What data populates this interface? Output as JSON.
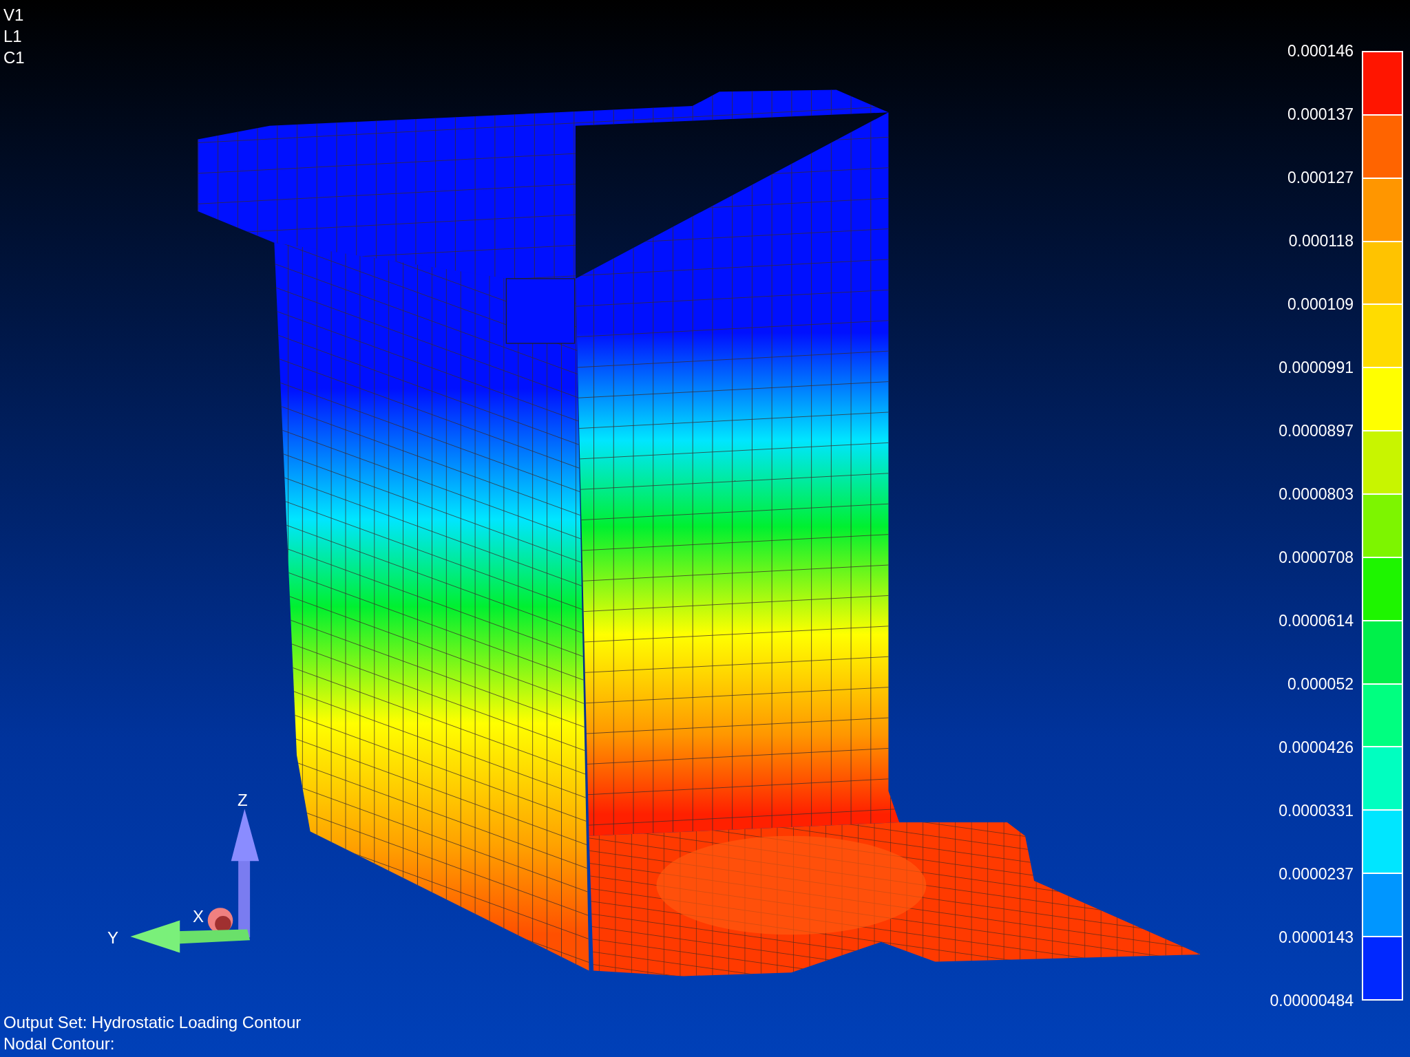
{
  "view_labels": [
    "V1",
    "L1",
    "C1"
  ],
  "legend": {
    "labels": [
      "0.000146",
      "0.000137",
      "0.000127",
      "0.000118",
      "0.000109",
      "0.0000991",
      "0.0000897",
      "0.0000803",
      "0.0000708",
      "0.0000614",
      "0.000052",
      "0.0000426",
      "0.0000331",
      "0.0000237",
      "0.0000143",
      "0.00000484"
    ],
    "bands": [
      {
        "color": "#ff1500"
      },
      {
        "color": "#ff6400"
      },
      {
        "color": "#ff9600"
      },
      {
        "color": "#ffc300"
      },
      {
        "color": "#ffdc00"
      },
      {
        "color": "#ffff00"
      },
      {
        "color": "#c8f500"
      },
      {
        "color": "#7df500"
      },
      {
        "color": "#1ef500"
      },
      {
        "color": "#00f04a"
      },
      {
        "color": "#00ff80"
      },
      {
        "color": "#00ffc0"
      },
      {
        "color": "#00e6ff"
      },
      {
        "color": "#0096ff"
      },
      {
        "color": "#0028ff"
      }
    ]
  },
  "triad": {
    "z_label": "Z",
    "y_label": "Y",
    "x_label": "X"
  },
  "footer": [
    "Output Set: Hydrostatic Loading Contour",
    "Nodal Contour:"
  ]
}
